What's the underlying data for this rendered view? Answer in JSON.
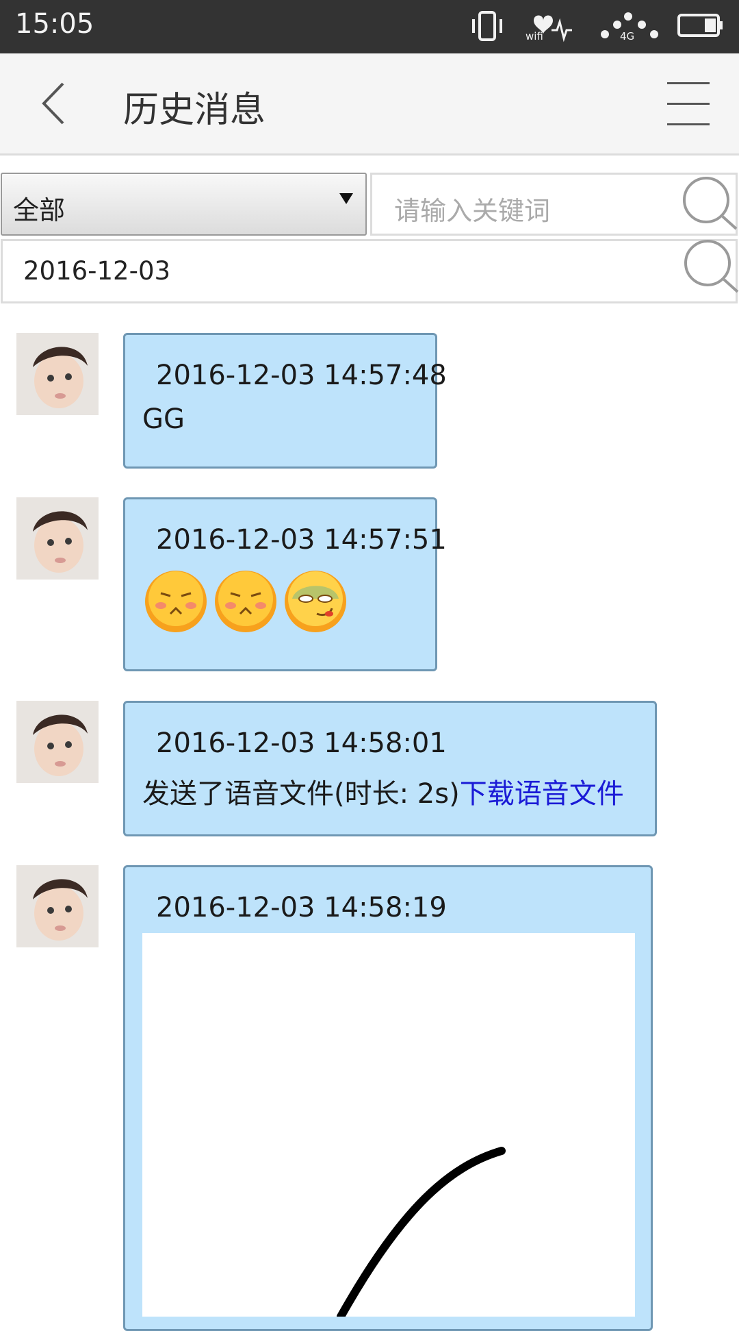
{
  "status_bar": {
    "time": "15:05",
    "icons": [
      "vibrate-icon",
      "wifi-icon",
      "signal-icon",
      "battery-icon"
    ],
    "wifi_label": "wifi",
    "network_label": "4G"
  },
  "header": {
    "title": "历史消息",
    "back_icon": "chevron-left-icon",
    "menu_icon": "hamburger-menu-icon"
  },
  "filter": {
    "type_selected": "全部",
    "keyword_placeholder": "请输入关键词",
    "date_value": "2016-12-03"
  },
  "messages": [
    {
      "timestamp": "2016-12-03 14:57:48",
      "text": "GG"
    },
    {
      "timestamp": "2016-12-03 14:57:51",
      "emojis": [
        "grumpy-face-emoji",
        "grumpy-face-emoji",
        "sick-face-emoji"
      ]
    },
    {
      "timestamp": "2016-12-03 14:58:01",
      "text": "发送了语音文件(时长: 2s)",
      "link": "下载语音文件"
    },
    {
      "timestamp": "2016-12-03 14:58:19",
      "attachment": "handwriting-image"
    }
  ],
  "colors": {
    "status_bar": "#333333",
    "header": "#f5f5f5",
    "bubble": "#bee3fb",
    "bubble_border": "#6f97b3",
    "link": "#1b1bd6"
  }
}
